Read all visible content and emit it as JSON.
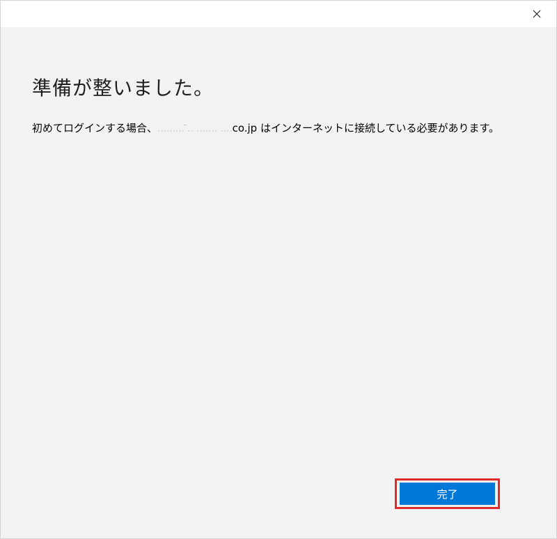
{
  "window": {
    "close_glyph": "close-icon"
  },
  "content": {
    "heading": "準備が整いました。",
    "message_before": "初めてログインする場合、",
    "message_redacted": "……… ̄‥ ‥‥… ….",
    "message_domain": "co.jp",
    "message_after": " はインターネットに接続している必要があります。"
  },
  "footer": {
    "done_label": "完了"
  },
  "colors": {
    "window_bg": "#f2f2f2",
    "titlebar_bg": "#ffffff",
    "accent": "#0078d7",
    "highlight": "#e02a2a"
  }
}
